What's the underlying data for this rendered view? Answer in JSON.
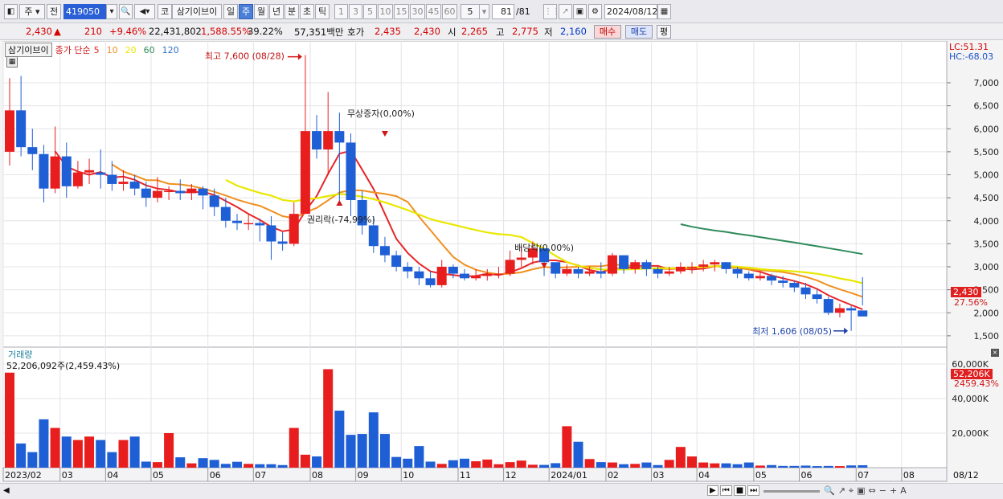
{
  "toolbar": {
    "period_type": "주",
    "market": "전",
    "code": "419050",
    "market_mode": "코",
    "stock_name": "삼기이브이",
    "intervals": [
      "일",
      "주",
      "월",
      "년",
      "분",
      "초",
      "틱"
    ],
    "selected_interval": "주",
    "minute_options": [
      "1",
      "3",
      "5",
      "10",
      "15",
      "30",
      "45",
      "60"
    ],
    "count_select": "5",
    "count": "81",
    "count_total": "/81",
    "date": "2024/08/12"
  },
  "quote": {
    "price": "2,430",
    "direction": "▲",
    "change": "210",
    "change_rate": "+9.46%",
    "volume": "22,431,802",
    "volume_rate": "1,588.55%",
    "turnover": "39.22%",
    "amount": "57,351백만",
    "ask_label": "호가",
    "ask": "2,435",
    "bid": "2,430",
    "open_label": "시",
    "open": "2,265",
    "high_label": "고",
    "high": "2,775",
    "low_label": "저",
    "low": "2,160",
    "buy_button": "매수",
    "sell_button": "매도",
    "eval_button": "평"
  },
  "legend": {
    "name": "삼기이브이",
    "series": "종가 단순",
    "ma": [
      {
        "period": "5",
        "color": "#e8262a"
      },
      {
        "period": "10",
        "color": "#f0901e"
      },
      {
        "period": "20",
        "color": "#e8e800"
      },
      {
        "period": "60",
        "color": "#2e8a5a"
      },
      {
        "period": "120",
        "color": "#2f6fc8"
      }
    ]
  },
  "lc_hc": {
    "lc": "LC:51.31",
    "hc": "HC:-68.03"
  },
  "annotations": {
    "high": "최고 7,600 (08/28)",
    "low": "최저 1,606 (08/05)",
    "bonus": "무상증자(0,00%)",
    "rights": "권리락(-74,99%)",
    "dividend": "배당락(0,00%)"
  },
  "price_axis": {
    "ticks": [
      "7,000",
      "6,500",
      "6,000",
      "5,500",
      "5,000",
      "4,500",
      "4,000",
      "3,500",
      "3,000",
      "2,500",
      "2,000",
      "1,500"
    ],
    "current_tag": "2,430",
    "current_rate_tag": "27.56%"
  },
  "volume_panel": {
    "title": "거래량",
    "value_text": "52,206,092주(2,459.43%)",
    "ticks": [
      "60,000K",
      "40,000K",
      "20,000K"
    ],
    "current_tag": "52,206K",
    "current_rate_tag": "2459.43%"
  },
  "x_axis": {
    "labels": [
      "2023/02",
      "03",
      "04",
      "05",
      "06",
      "07",
      "08",
      "09",
      "10",
      "11",
      "12",
      "2024/01",
      "02",
      "03",
      "04",
      "05",
      "06",
      "07",
      "08"
    ],
    "end_label": "08/12"
  },
  "colors": {
    "up": "#e81e1e",
    "down": "#1e5fd6",
    "background": "#ffffff"
  },
  "chart_data": {
    "type": "candlestick",
    "x": [
      "2023-02-06",
      "2023-02-13",
      "2023-02-20",
      "2023-02-27",
      "2023-03-06",
      "2023-03-13",
      "2023-03-20",
      "2023-03-27",
      "2023-04-03",
      "2023-04-10",
      "2023-04-17",
      "2023-04-24",
      "2023-05-01",
      "2023-05-08",
      "2023-05-15",
      "2023-05-22",
      "2023-05-29",
      "2023-06-05",
      "2023-06-12",
      "2023-06-19",
      "2023-06-26",
      "2023-07-03",
      "2023-07-10",
      "2023-07-17",
      "2023-07-24",
      "2023-07-31",
      "2023-08-07",
      "2023-08-14",
      "2023-08-21",
      "2023-08-28",
      "2023-09-04",
      "2023-09-11",
      "2023-09-18",
      "2023-09-25",
      "2023-10-02",
      "2023-10-09",
      "2023-10-16",
      "2023-10-23",
      "2023-10-30",
      "2023-11-06",
      "2023-11-13",
      "2023-11-20",
      "2023-11-27",
      "2023-12-04",
      "2023-12-11",
      "2023-12-18",
      "2023-12-25",
      "2024-01-01",
      "2024-01-08",
      "2024-01-15",
      "2024-01-22",
      "2024-01-29",
      "2024-02-05",
      "2024-02-12",
      "2024-02-19",
      "2024-02-26",
      "2024-03-04",
      "2024-03-11",
      "2024-03-18",
      "2024-03-25",
      "2024-04-01",
      "2024-04-08",
      "2024-04-15",
      "2024-04-22",
      "2024-04-29",
      "2024-05-06",
      "2024-05-13",
      "2024-05-20",
      "2024-05-27",
      "2024-06-03",
      "2024-06-10",
      "2024-06-17",
      "2024-06-24",
      "2024-07-01",
      "2024-07-08",
      "2024-07-15",
      "2024-07-22",
      "2024-07-29",
      "2024-08-05",
      "2024-08-12"
    ],
    "open": [
      5500,
      6400,
      5600,
      5450,
      4700,
      5400,
      4750,
      5050,
      5050,
      5000,
      4800,
      4850,
      4700,
      4500,
      4650,
      4650,
      4600,
      4700,
      4550,
      4300,
      4000,
      3950,
      3950,
      3900,
      3550,
      3500,
      4150,
      5950,
      5550,
      5950,
      5700,
      4450,
      3900,
      3450,
      3250,
      3000,
      2900,
      2750,
      2600,
      3000,
      2850,
      2750,
      2800,
      2850,
      2850,
      3150,
      3200,
      3400,
      3100,
      2850,
      2950,
      2850,
      2900,
      2850,
      3250,
      2950,
      3100,
      2950,
      2850,
      2900,
      3000,
      3000,
      3050,
      3100,
      2950,
      2850,
      2750,
      2800,
      2700,
      2650,
      2550,
      2400,
      2300,
      2000,
      2100,
      2050
    ],
    "close": [
      6400,
      5600,
      5450,
      4700,
      5400,
      4750,
      5050,
      5100,
      5000,
      4800,
      4850,
      4700,
      4500,
      4650,
      4650,
      4600,
      4700,
      4550,
      4300,
      4000,
      3950,
      3950,
      3900,
      3550,
      3500,
      4150,
      5950,
      5550,
      5950,
      5700,
      4450,
      3900,
      3450,
      3250,
      3000,
      2900,
      2750,
      2600,
      3000,
      2850,
      2750,
      2800,
      2850,
      2850,
      3150,
      3200,
      3400,
      3100,
      2850,
      2950,
      2850,
      2900,
      2850,
      3250,
      2950,
      3100,
      2950,
      2850,
      2900,
      3000,
      3000,
      3050,
      3100,
      2950,
      2850,
      2750,
      2800,
      2700,
      2650,
      2550,
      2400,
      2300,
      2000,
      2100,
      2050,
      1920
    ],
    "high": [
      7100,
      7150,
      6000,
      5650,
      6050,
      5700,
      5300,
      5350,
      5550,
      5300,
      5100,
      5000,
      4850,
      4950,
      4750,
      4900,
      4800,
      4750,
      4700,
      4500,
      4150,
      4150,
      4050,
      4100,
      3750,
      4400,
      7600,
      6300,
      6800,
      6350,
      5900,
      4650,
      4100,
      3650,
      3350,
      3100,
      3000,
      2900,
      3150,
      3050,
      2950,
      2950,
      2950,
      3000,
      3350,
      3450,
      3550,
      3300,
      3000,
      3050,
      3000,
      3000,
      3100,
      3300,
      3250,
      3150,
      3150,
      3000,
      3000,
      3100,
      3100,
      3150,
      3150,
      3100,
      3000,
      2900,
      2900,
      2850,
      2800,
      2700,
      2650,
      2500,
      2350,
      2200,
      2150,
      2775
    ],
    "low": [
      5200,
      5400,
      5100,
      4400,
      4600,
      4500,
      4700,
      4800,
      4700,
      4650,
      4650,
      4550,
      4300,
      4400,
      4450,
      4450,
      4450,
      4250,
      4100,
      3850,
      3800,
      3800,
      3550,
      3150,
      3350,
      3450,
      4150,
      5350,
      5000,
      4400,
      4100,
      3700,
      3300,
      3100,
      2900,
      2750,
      2600,
      2550,
      2550,
      2750,
      2700,
      2700,
      2700,
      2750,
      2800,
      3000,
      3050,
      2800,
      2750,
      2800,
      2750,
      2800,
      2750,
      2800,
      2850,
      2850,
      2800,
      2750,
      2800,
      2850,
      2850,
      2900,
      2900,
      2850,
      2750,
      2700,
      2700,
      2600,
      2550,
      2450,
      2300,
      2200,
      1950,
      1900,
      1606,
      2160
    ],
    "volume_k": [
      55000,
      14000,
      9000,
      28000,
      23000,
      18000,
      16000,
      18000,
      16000,
      9000,
      16000,
      18000,
      3500,
      3200,
      20000,
      6000,
      2500,
      5500,
      4500,
      2200,
      3400,
      2200,
      2000,
      2000,
      1500,
      23000,
      7500,
      6500,
      57000,
      33000,
      19000,
      19500,
      32000,
      19500,
      6200,
      5200,
      12500,
      3500,
      2200,
      4300,
      5200,
      3700,
      4700,
      2000,
      3200,
      4100,
      1700,
      1600,
      2600,
      24000,
      15000,
      5000,
      3200,
      3000,
      2000,
      2200,
      3000,
      1500,
      4500,
      12000,
      6500,
      3000,
      2500,
      2500,
      2000,
      3000,
      1200,
      1500,
      1000,
      1000,
      1200,
      900,
      1000,
      900,
      1300,
      1400,
      1300,
      8000,
      2000,
      1100,
      1600,
      52206
    ]
  }
}
